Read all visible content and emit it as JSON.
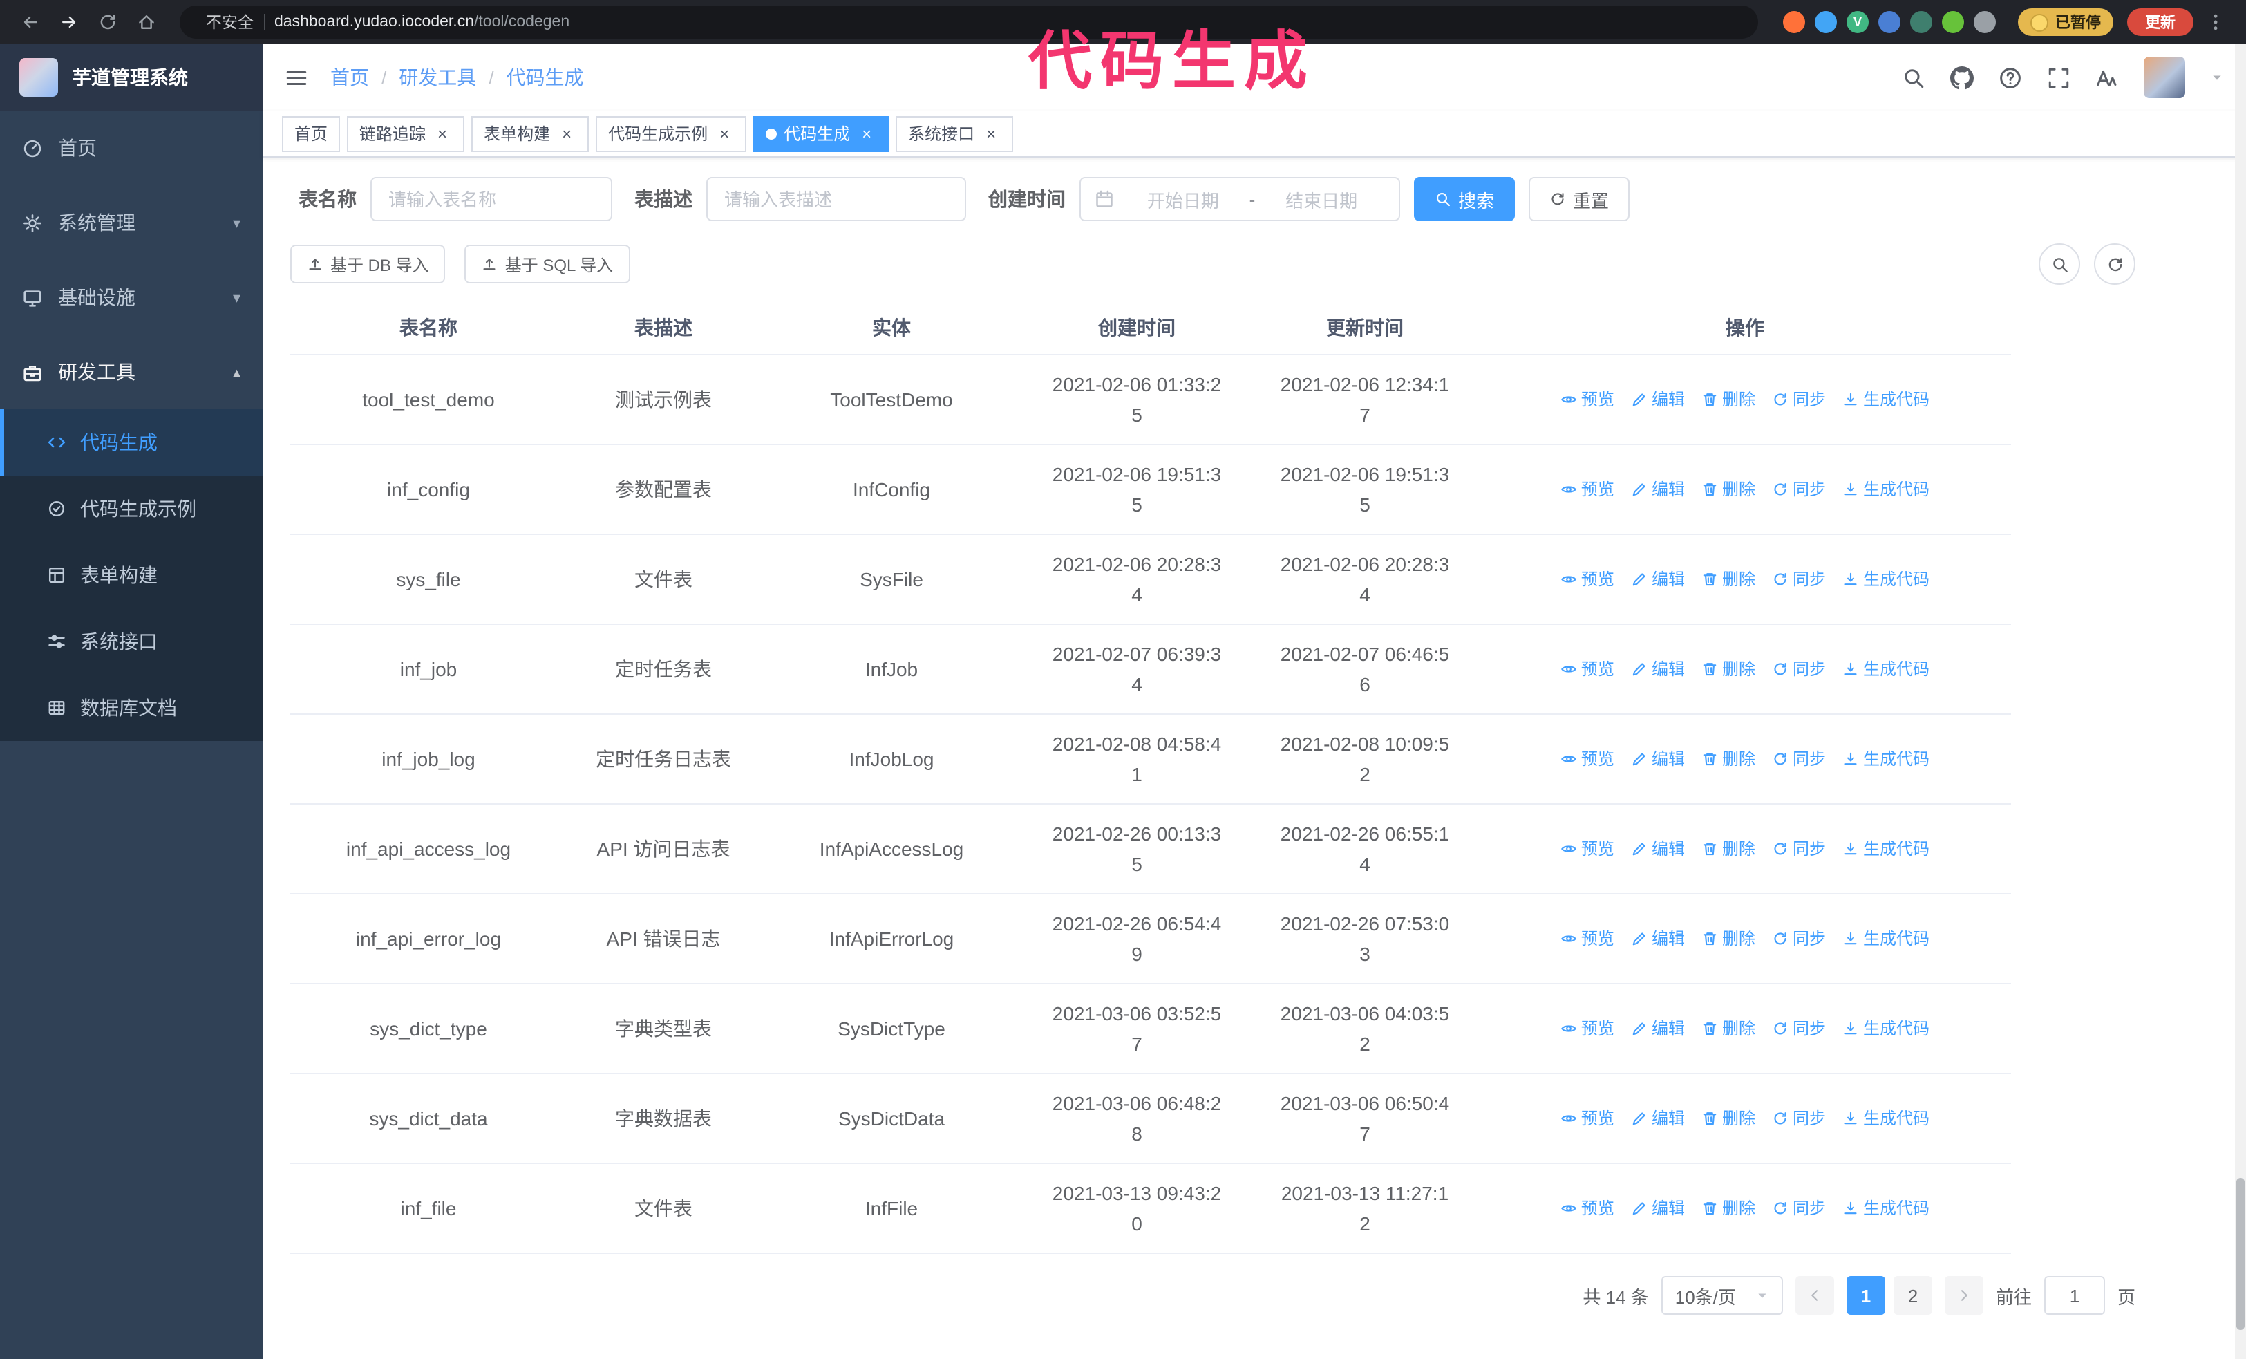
{
  "theme": {
    "primary": "#409eff",
    "sidebar_bg": "#304156",
    "submenu_bg": "#1f2d3d",
    "menu_text": "#bfcbd9",
    "annotation_pink": "#f3366f",
    "update_red": "#d94a3d",
    "paused_yellow": "#e5b84e",
    "tab_border": "#d8dce5",
    "table_border": "#ebeef5",
    "placeholder": "#c0c4cc"
  },
  "annotation": {
    "text": "代码生成"
  },
  "browser": {
    "security_label": "不安全",
    "url_host": "dashboard.yudao.iocoder.cn",
    "url_path": "/tool/codegen",
    "paused_badge": "已暂停",
    "update_button": "更新",
    "extensions": [
      {
        "name": "extension-orange",
        "color": "#ff7139",
        "letter": ""
      },
      {
        "name": "extension-blue-drop",
        "color": "#42a5f5",
        "letter": ""
      },
      {
        "name": "extension-vue-devtools",
        "color": "#41b883",
        "letter": "V"
      },
      {
        "name": "extension-people",
        "color": "#4a7fd4",
        "letter": ""
      },
      {
        "name": "extension-teal",
        "color": "#3f7f6e",
        "letter": ""
      },
      {
        "name": "extension-leaf",
        "color": "#67c23a",
        "letter": ""
      },
      {
        "name": "extension-puzzle",
        "color": "#9aa0a6",
        "letter": ""
      }
    ]
  },
  "sidebar": {
    "app_title": "芋道管理系统",
    "items": [
      {
        "id": "home",
        "label": "首页",
        "icon": "dashboard",
        "caret": "",
        "expanded": false
      },
      {
        "id": "system",
        "label": "系统管理",
        "icon": "gear",
        "caret": "down",
        "expanded": false
      },
      {
        "id": "infra",
        "label": "基础设施",
        "icon": "monitor",
        "caret": "down",
        "expanded": false
      },
      {
        "id": "dev-tools",
        "label": "研发工具",
        "icon": "toolbox",
        "caret": "up",
        "expanded": true
      }
    ],
    "submenu": [
      {
        "id": "codegen",
        "label": "代码生成",
        "icon": "code",
        "active": true
      },
      {
        "id": "codegen-example",
        "label": "代码生成示例",
        "icon": "check-badge",
        "active": false
      },
      {
        "id": "form-builder",
        "label": "表单构建",
        "icon": "form",
        "active": false
      },
      {
        "id": "api",
        "label": "系统接口",
        "icon": "sliders",
        "active": false
      },
      {
        "id": "db-doc",
        "label": "数据库文档",
        "icon": "grid",
        "active": false
      }
    ]
  },
  "header": {
    "breadcrumb": [
      {
        "id": "home",
        "label": "首页"
      },
      {
        "id": "dev-tools",
        "label": "研发工具"
      },
      {
        "id": "codegen",
        "label": "代码生成"
      }
    ],
    "icons": [
      {
        "name": "search",
        "icon": "search"
      },
      {
        "name": "github",
        "icon": "github"
      },
      {
        "name": "help",
        "icon": "question"
      },
      {
        "name": "fullscreen",
        "icon": "fullscreen"
      },
      {
        "name": "font-size",
        "icon": "fontsize"
      }
    ]
  },
  "tabs": [
    {
      "id": "home",
      "label": "首页",
      "closable": false,
      "active": false
    },
    {
      "id": "trace",
      "label": "链路追踪",
      "closable": true,
      "active": false
    },
    {
      "id": "form-builder",
      "label": "表单构建",
      "closable": true,
      "active": false
    },
    {
      "id": "codegen-example",
      "label": "代码生成示例",
      "closable": true,
      "active": false
    },
    {
      "id": "codegen",
      "label": "代码生成",
      "closable": true,
      "active": true
    },
    {
      "id": "api",
      "label": "系统接口",
      "closable": true,
      "active": false
    }
  ],
  "filters": {
    "table_name_label": "表名称",
    "table_name_placeholder": "请输入表名称",
    "table_desc_label": "表描述",
    "table_desc_placeholder": "请输入表描述",
    "create_time_label": "创建时间",
    "date_start_placeholder": "开始日期",
    "date_separator": "-",
    "date_end_placeholder": "结束日期",
    "search_button": "搜索",
    "reset_button": "重置"
  },
  "toolbar": {
    "import_db": "基于 DB 导入",
    "import_sql": "基于 SQL 导入"
  },
  "table": {
    "columns": [
      "表名称",
      "表描述",
      "实体",
      "创建时间",
      "更新时间",
      "操作"
    ],
    "actions": [
      "预览",
      "编辑",
      "删除",
      "同步",
      "生成代码"
    ],
    "action_ids": [
      "preview",
      "edit",
      "delete",
      "sync",
      "generate-code"
    ],
    "action_icons": [
      "eye",
      "edit",
      "trash",
      "sync",
      "download"
    ],
    "rows": [
      {
        "name": "tool_test_demo",
        "desc": "测试示例表",
        "entity": "ToolTestDemo",
        "created": "2021-02-06 01:33:25",
        "updated": "2021-02-06 12:34:17"
      },
      {
        "name": "inf_config",
        "desc": "参数配置表",
        "entity": "InfConfig",
        "created": "2021-02-06 19:51:35",
        "updated": "2021-02-06 19:51:35"
      },
      {
        "name": "sys_file",
        "desc": "文件表",
        "entity": "SysFile",
        "created": "2021-02-06 20:28:34",
        "updated": "2021-02-06 20:28:34"
      },
      {
        "name": "inf_job",
        "desc": "定时任务表",
        "entity": "InfJob",
        "created": "2021-02-07 06:39:34",
        "updated": "2021-02-07 06:46:56"
      },
      {
        "name": "inf_job_log",
        "desc": "定时任务日志表",
        "entity": "InfJobLog",
        "created": "2021-02-08 04:58:41",
        "updated": "2021-02-08 10:09:52"
      },
      {
        "name": "inf_api_access_log",
        "desc": "API 访问日志表",
        "entity": "InfApiAccessLog",
        "created": "2021-02-26 00:13:35",
        "updated": "2021-02-26 06:55:14"
      },
      {
        "name": "inf_api_error_log",
        "desc": "API 错误日志",
        "entity": "InfApiErrorLog",
        "created": "2021-02-26 06:54:49",
        "updated": "2021-02-26 07:53:03"
      },
      {
        "name": "sys_dict_type",
        "desc": "字典类型表",
        "entity": "SysDictType",
        "created": "2021-03-06 03:52:57",
        "updated": "2021-03-06 04:03:52"
      },
      {
        "name": "sys_dict_data",
        "desc": "字典数据表",
        "entity": "SysDictData",
        "created": "2021-03-06 06:48:28",
        "updated": "2021-03-06 06:50:47"
      },
      {
        "name": "inf_file",
        "desc": "文件表",
        "entity": "InfFile",
        "created": "2021-03-13 09:43:20",
        "updated": "2021-03-13 11:27:12"
      }
    ]
  },
  "pagination": {
    "total_label": "共 14 条",
    "page_size_label": "10条/页",
    "pages": [
      "1",
      "2"
    ],
    "active_page": "1",
    "goto_label": "前往",
    "goto_value": "1",
    "goto_suffix": "页"
  }
}
